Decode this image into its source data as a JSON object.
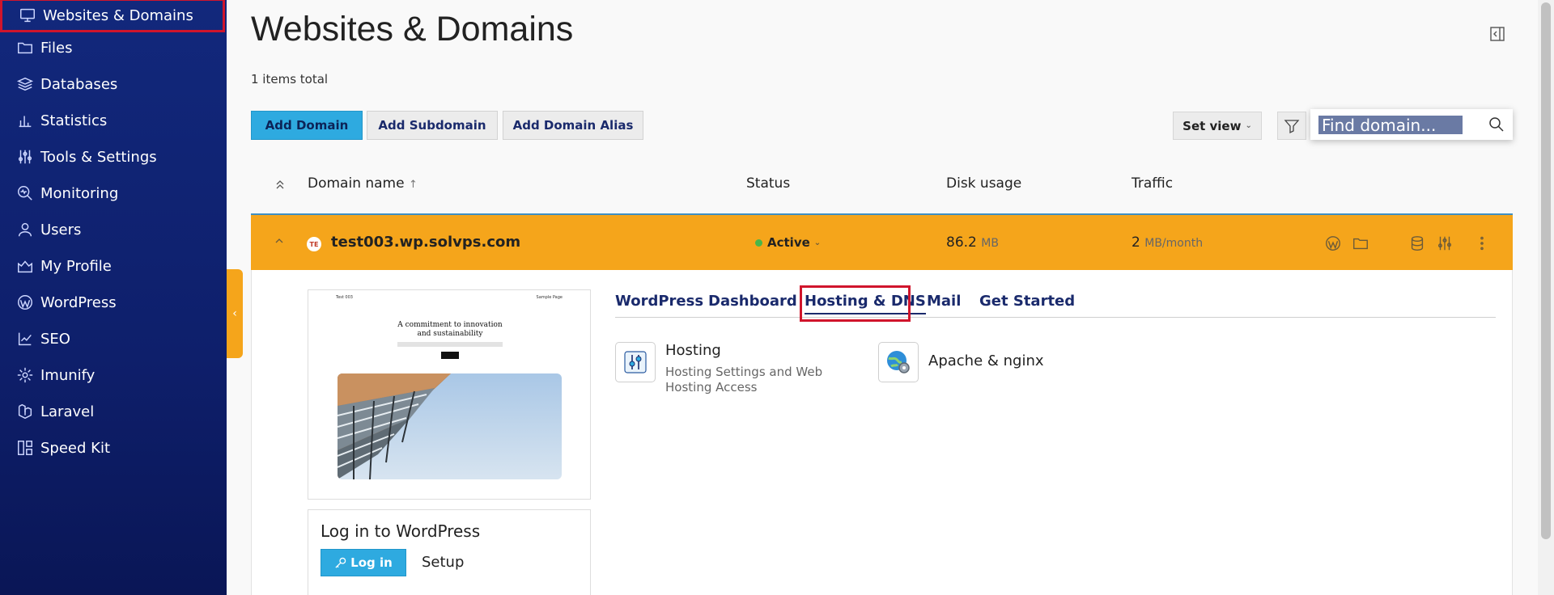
{
  "sidebar": {
    "items": [
      {
        "label": "Websites & Domains",
        "icon": "monitor-icon"
      },
      {
        "label": "Files",
        "icon": "folder-icon"
      },
      {
        "label": "Databases",
        "icon": "layers-icon"
      },
      {
        "label": "Statistics",
        "icon": "bar-chart-icon"
      },
      {
        "label": "Tools & Settings",
        "icon": "sliders-icon"
      },
      {
        "label": "Monitoring",
        "icon": "magnifier-pulse-icon"
      },
      {
        "label": "Users",
        "icon": "user-icon"
      },
      {
        "label": "My Profile",
        "icon": "profile-icon"
      },
      {
        "label": "WordPress",
        "icon": "wordpress-icon"
      },
      {
        "label": "SEO",
        "icon": "growth-chart-icon"
      },
      {
        "label": "Imunify",
        "icon": "gear-icon"
      },
      {
        "label": "Laravel",
        "icon": "laravel-icon"
      },
      {
        "label": "Speed Kit",
        "icon": "blocks-icon"
      }
    ]
  },
  "header": {
    "title": "Websites & Domains",
    "items_total": "1 items total"
  },
  "toolbar": {
    "add_domain": "Add Domain",
    "add_subdomain": "Add Subdomain",
    "add_domain_alias": "Add Domain Alias",
    "set_view": "Set view",
    "search_placeholder": "Find domain..."
  },
  "table": {
    "columns": {
      "domain_name": "Domain name",
      "status": "Status",
      "disk_usage": "Disk usage",
      "traffic": "Traffic"
    },
    "sort_arrow": "↑",
    "rows": [
      {
        "favicon_text": "TE",
        "domain": "test003.wp.solvps.com",
        "status": "Active",
        "disk_value": "86.2",
        "disk_unit": "MB",
        "traffic_value": "2",
        "traffic_unit": "MB/month"
      }
    ]
  },
  "preview": {
    "brand": "Test 003",
    "nav": "Sample Page",
    "headline_1": "A commitment to innovation",
    "headline_2": "and sustainability"
  },
  "login_card": {
    "title": "Log in to WordPress",
    "login_button": "Log in",
    "setup_link": "Setup"
  },
  "tabs": [
    {
      "label": "WordPress"
    },
    {
      "label": "Dashboard"
    },
    {
      "label": "Hosting & DNS"
    },
    {
      "label": "Mail"
    },
    {
      "label": "Get Started"
    }
  ],
  "active_tab": "Hosting & DNS",
  "tools": [
    {
      "title": "Hosting",
      "description": "Hosting Settings and Web Hosting Access",
      "icon": "hosting-settings-icon"
    },
    {
      "title": "Apache & nginx",
      "icon": "globe-gear-icon"
    }
  ],
  "colors": {
    "sidebar_bg": "#12287c",
    "accent_orange": "#f5a51b",
    "primary_blue": "#2eaae0",
    "highlight_red": "#d0152c",
    "status_green": "#49b649"
  }
}
